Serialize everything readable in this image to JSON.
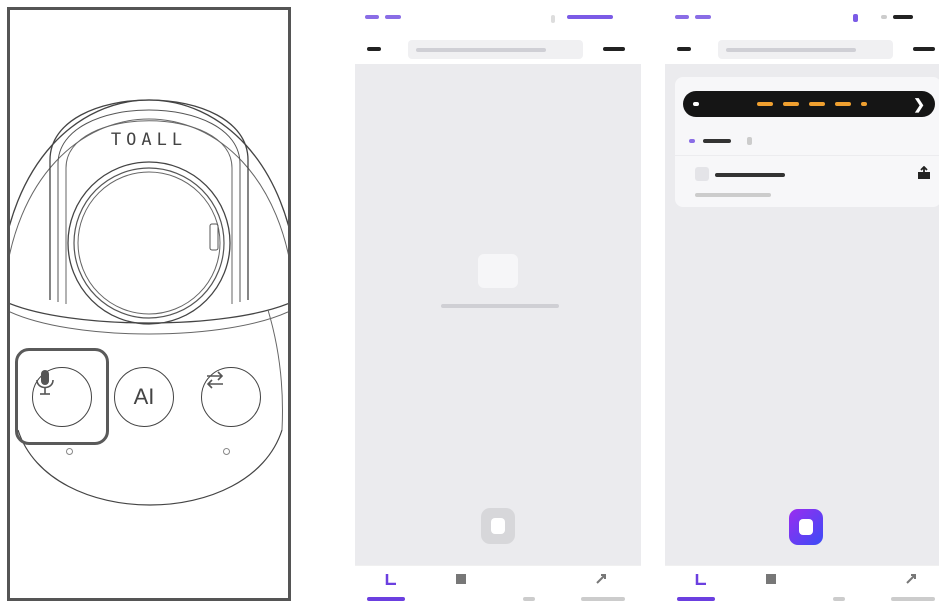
{
  "device": {
    "brand": "TOALL",
    "buttons": [
      {
        "id": "mic",
        "label": "",
        "icon": "microphone-icon"
      },
      {
        "id": "ai",
        "label": "AI",
        "icon": ""
      },
      {
        "id": "swap",
        "label": "",
        "icon": "swap-arrows-icon"
      }
    ],
    "highlighted_button": "mic"
  },
  "screens": [
    {
      "id": "empty-list",
      "state": "empty",
      "mic_button_color": "#d7d7da",
      "tabs": [
        {
          "icon": "home-icon",
          "active": true
        },
        {
          "icon": "file-icon",
          "active": false
        },
        {
          "icon": "blank-icon",
          "active": false
        },
        {
          "icon": "profile-icon",
          "active": false
        }
      ]
    },
    {
      "id": "recording-list",
      "state": "recording",
      "banner_color": "#151515",
      "banner_accent": "#f0a030",
      "mic_button_color": "#7a34f2",
      "tabs": [
        {
          "icon": "home-icon",
          "active": true
        },
        {
          "icon": "file-icon",
          "active": false
        },
        {
          "icon": "blank-icon",
          "active": false
        },
        {
          "icon": "profile-icon",
          "active": false
        }
      ]
    }
  ],
  "colors": {
    "accent": "#6b3fe0",
    "screen_bg": "#ebebee",
    "device_stroke": "#444444"
  }
}
